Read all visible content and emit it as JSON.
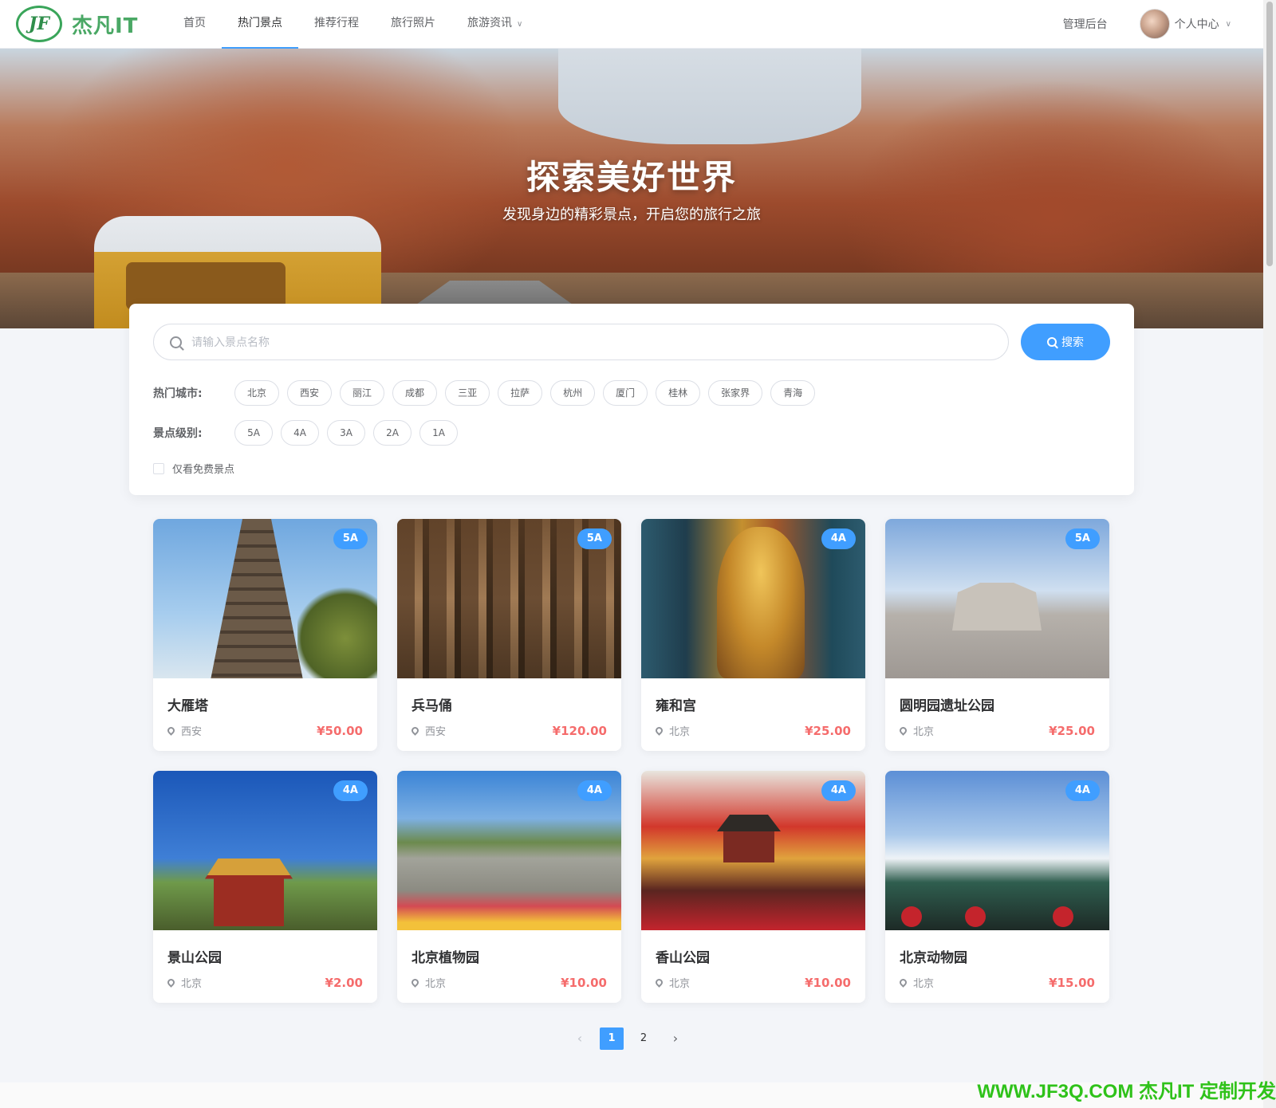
{
  "header": {
    "logo_mark": "JF",
    "logo_text": "杰凡IT",
    "nav": [
      {
        "label": "首页",
        "active": false
      },
      {
        "label": "热门景点",
        "active": true
      },
      {
        "label": "推荐行程",
        "active": false
      },
      {
        "label": "旅行照片",
        "active": false
      },
      {
        "label": "旅游资讯",
        "active": false,
        "dropdown": true
      }
    ],
    "admin_label": "管理后台",
    "user_label": "个人中心"
  },
  "hero": {
    "title": "探索美好世界",
    "subtitle": "发现身边的精彩景点，开启您的旅行之旅"
  },
  "search": {
    "placeholder": "请输入景点名称",
    "value": "",
    "button_label": "搜索"
  },
  "filters": {
    "city_label": "热门城市:",
    "cities": [
      "北京",
      "西安",
      "丽江",
      "成都",
      "三亚",
      "拉萨",
      "杭州",
      "厦门",
      "桂林",
      "张家界",
      "青海"
    ],
    "level_label": "景点级别:",
    "levels": [
      "5A",
      "4A",
      "3A",
      "2A",
      "1A"
    ],
    "free_only_label": "仅看免费景点",
    "free_only_checked": false
  },
  "spots": [
    {
      "name": "大雁塔",
      "city": "西安",
      "price": "¥50.00",
      "level": "5A",
      "image": "pagoda"
    },
    {
      "name": "兵马俑",
      "city": "西安",
      "price": "¥120.00",
      "level": "5A",
      "image": "warriors"
    },
    {
      "name": "雍和宫",
      "city": "北京",
      "price": "¥25.00",
      "level": "4A",
      "image": "temple"
    },
    {
      "name": "圆明园遗址公园",
      "city": "北京",
      "price": "¥25.00",
      "level": "5A",
      "image": "ruins"
    },
    {
      "name": "景山公园",
      "city": "北京",
      "price": "¥2.00",
      "level": "4A",
      "image": "jingshan"
    },
    {
      "name": "北京植物园",
      "city": "北京",
      "price": "¥10.00",
      "level": "4A",
      "image": "botanic"
    },
    {
      "name": "香山公园",
      "city": "北京",
      "price": "¥10.00",
      "level": "4A",
      "image": "xiangshan"
    },
    {
      "name": "北京动物园",
      "city": "北京",
      "price": "¥15.00",
      "level": "4A",
      "image": "zoo"
    }
  ],
  "pagination": {
    "pages": [
      "1",
      "2"
    ],
    "current": 1
  },
  "watermark": "WWW.JF3Q.COM 杰凡IT 定制开发",
  "colors": {
    "accent": "#409eff",
    "price": "#f56c6c",
    "logo_green": "#4aa865"
  },
  "icons": {
    "search": "search-icon",
    "location": "map-pin-icon",
    "dropdown": "chevron-down-icon",
    "prev": "chevron-left-icon",
    "next": "chevron-right-icon"
  }
}
